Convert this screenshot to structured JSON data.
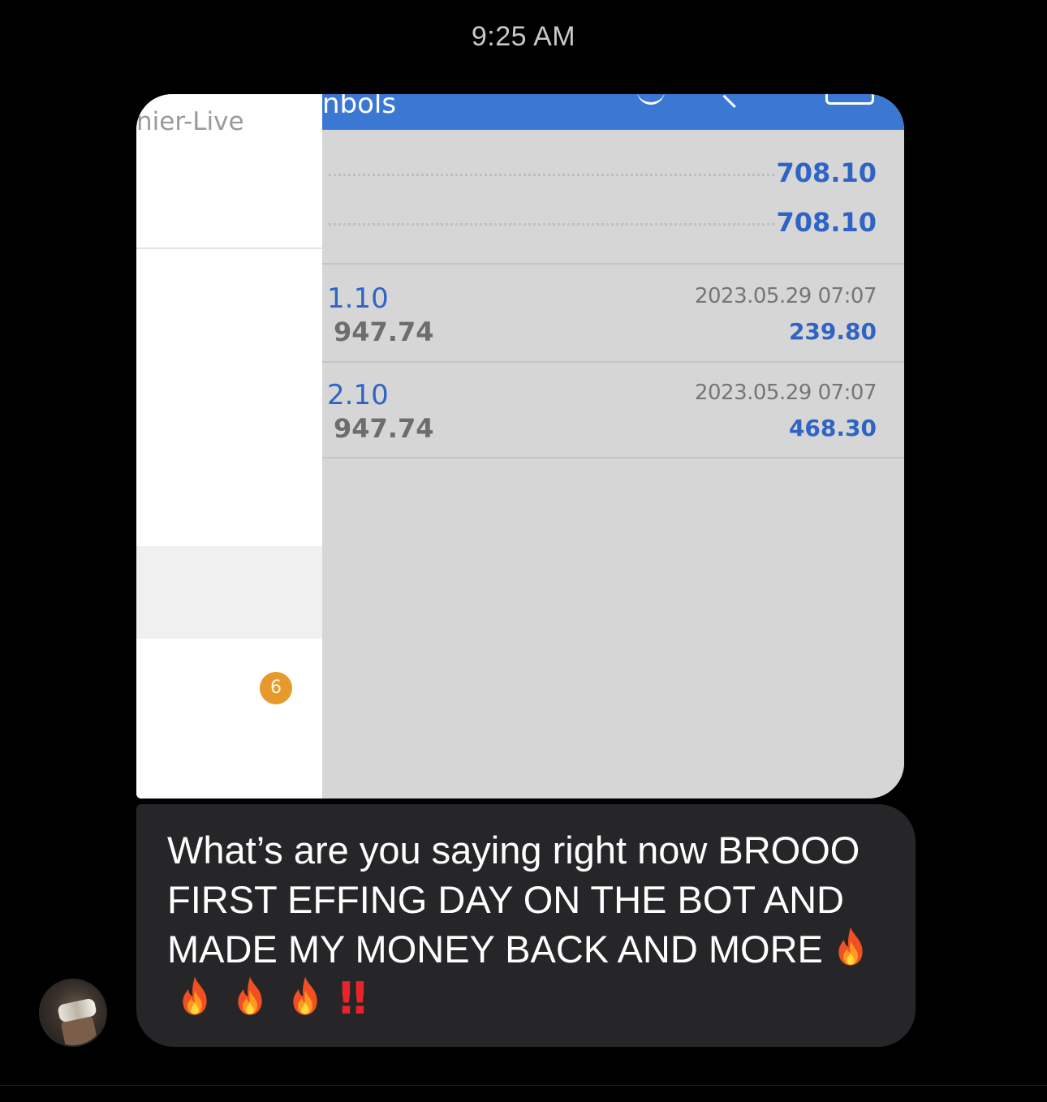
{
  "timestamp": "9:25 AM",
  "attachment": {
    "side_panel": {
      "title": "nier-Live",
      "badge_count": "6"
    },
    "topbar": {
      "title": "nbols",
      "color": "#3b78d4"
    },
    "summary_values": [
      "708.10",
      "708.10"
    ],
    "trades": [
      {
        "lots": "1.10",
        "price": "947.74",
        "time": "2023.05.29 07:07",
        "profit": "239.80"
      },
      {
        "lots": "2.10",
        "price": "947.74",
        "time": "2023.05.29 07:07",
        "profit": "468.30"
      }
    ]
  },
  "message": {
    "text": "What’s are you saying right now BROOO FIRST EFFING DAY ON THE BOT AND MADE MY MONEY BACK AND MORE",
    "trailing_emoji": [
      "fire-emoji",
      "fire-emoji",
      "fire-emoji",
      "fire-emoji"
    ],
    "exclamation": "‼",
    "bubble_color": "#262628"
  },
  "avatar": {
    "icon": "user-avatar"
  }
}
